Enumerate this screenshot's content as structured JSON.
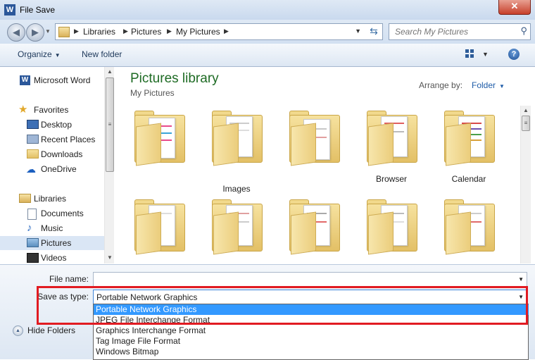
{
  "window": {
    "title": "File Save",
    "close_label": "✕"
  },
  "address": {
    "crumbs": [
      "Libraries",
      "Pictures",
      "My Pictures"
    ],
    "search_placeholder": "Search My Pictures"
  },
  "toolbar": {
    "organize": "Organize",
    "new_folder": "New folder",
    "help": "?"
  },
  "nav": {
    "items": [
      {
        "label": "Microsoft Word"
      },
      {
        "label": "Favorites"
      },
      {
        "label": "Desktop"
      },
      {
        "label": "Recent Places"
      },
      {
        "label": "Downloads"
      },
      {
        "label": "OneDrive"
      },
      {
        "label": "Libraries"
      },
      {
        "label": "Documents"
      },
      {
        "label": "Music"
      },
      {
        "label": "Pictures"
      },
      {
        "label": "Videos"
      }
    ],
    "selected": "Pictures"
  },
  "library": {
    "title": "Pictures library",
    "subtitle": "My Pictures",
    "arrange_label": "Arrange by:",
    "arrange_value": "Folder",
    "folders": [
      "",
      "Images",
      "",
      "Browser",
      "Calendar",
      "",
      "",
      "",
      "",
      ""
    ]
  },
  "form": {
    "file_name_label": "File name:",
    "file_name_value": "",
    "save_type_label": "Save as type:",
    "save_type_value": "Portable Network Graphics",
    "type_options": [
      "Portable Network Graphics",
      "JPEG File Interchange Format",
      "Graphics Interchange Format",
      "Tag Image File Format",
      "Windows Bitmap"
    ],
    "hide_folders": "Hide Folders"
  },
  "colors": {
    "highlight_box": "#e11b22",
    "selection": "#3399ff",
    "library_title": "#1e6b24"
  }
}
